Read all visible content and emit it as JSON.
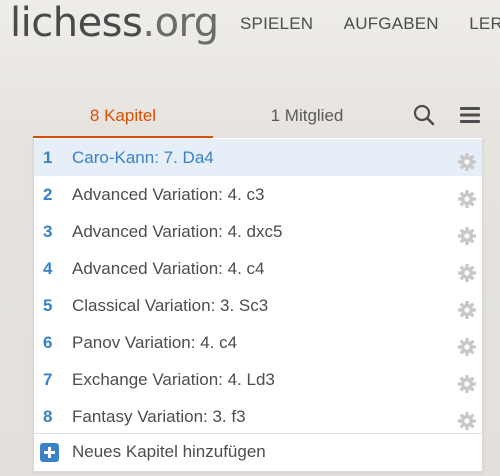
{
  "header": {
    "logo_name": "lichess",
    "logo_tld": ".org",
    "nav": [
      "SPIELEN",
      "AUFGABEN",
      "LERN"
    ]
  },
  "tabs": {
    "chapters": "8 Kapitel",
    "members": "1 Mitglied",
    "search_icon": "search-icon",
    "menu_icon": "hamburger-menu-icon"
  },
  "chapters": [
    {
      "num": "1",
      "name": "Caro-Kann: 7. Da4",
      "active": true
    },
    {
      "num": "2",
      "name": "Advanced Variation: 4. c3"
    },
    {
      "num": "3",
      "name": "Advanced Variation: 4. dxc5"
    },
    {
      "num": "4",
      "name": "Advanced Variation: 4. c4"
    },
    {
      "num": "5",
      "name": "Classical Variation: 3. Sc3"
    },
    {
      "num": "6",
      "name": "Panov Variation: 4. c4"
    },
    {
      "num": "7",
      "name": "Exchange Variation: 4. Ld3"
    },
    {
      "num": "8",
      "name": "Fantasy Variation: 3. f3"
    }
  ],
  "add_chapter": "Neues Kapitel hinzufügen",
  "colors": {
    "accent_active_tab": "#d85000",
    "chapter_blue": "#3a81c8",
    "active_row_bg": "#e6eef8",
    "gear_gray": "#c8c8c8"
  }
}
